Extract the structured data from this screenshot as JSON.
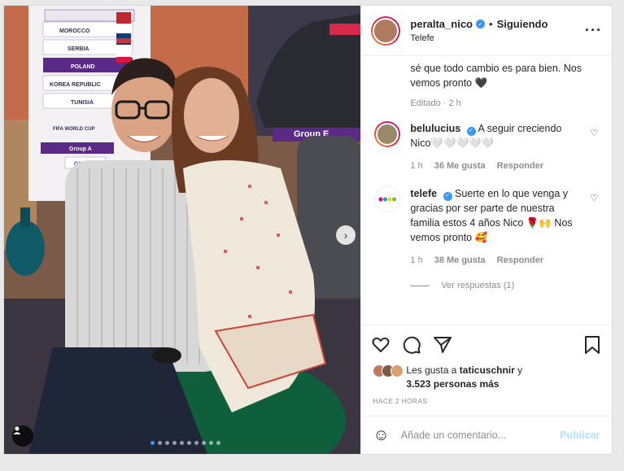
{
  "post": {
    "username": "peralta_nico",
    "follow_status": "Siguiendo",
    "location": "Telefe",
    "caption_text": "sé que todo cambio es para bien. Nos vemos pronto 🖤",
    "caption_edited": "Editado · 2 h"
  },
  "comments": [
    {
      "username": "belulucius",
      "text": "A seguir creciendo Nico🤍🤍🤍🤍🤍",
      "time": "1 h",
      "likes": "36 Me gusta",
      "reply": "Responder"
    },
    {
      "username": "telefe",
      "text": "Suerte en lo que venga y gracias por ser parte de nuestra familia estos 4 años Nico 🌹🙌 Nos vemos pronto 🥰",
      "time": "1 h",
      "likes": "38 Me gusta",
      "reply": "Responder",
      "view_replies": "Ver respuestas (1)"
    }
  ],
  "likes": {
    "prefix": "Les gusta a",
    "first_user": "taticuschnir",
    "connector": "y",
    "count_text": "3.523 personas más"
  },
  "time_ago": "HACE 2 HORAS",
  "add_comment": {
    "placeholder": "Añade un comentario...",
    "publish": "Publicar"
  },
  "image_text": {
    "group_a": "Group A",
    "group_e": "Group E",
    "world_cup": "FIFA WORLD CUP",
    "teams": [
      "MOROCCO",
      "SERBIA",
      "POLAND",
      "KOREA REPUBLIC",
      "TUNISIA",
      "QATAR"
    ]
  },
  "colors": {
    "verified": "#3897f0",
    "publish_disabled": "#b2dffc",
    "carousel_active": "#3897f0",
    "accent_purple": "#5b2a86"
  },
  "carousel": {
    "total": 10,
    "active_index": 0
  }
}
